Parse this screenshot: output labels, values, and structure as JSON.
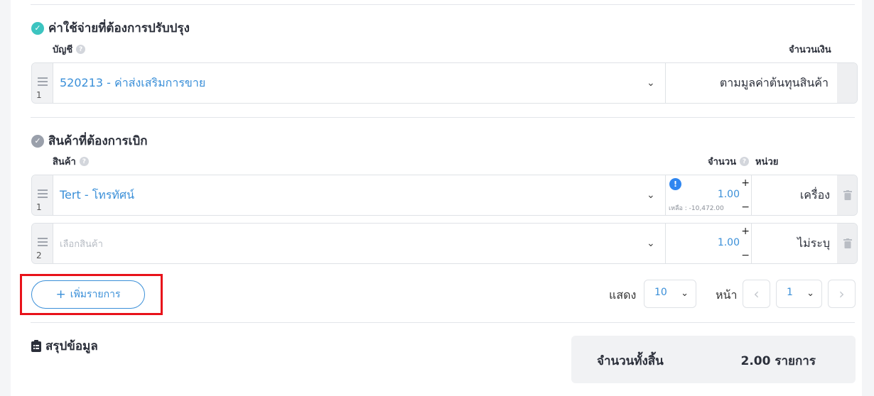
{
  "expense_section": {
    "title": "ค่าใช้จ่ายที่ต้องการปรับปรุง",
    "account_header": "บัญชี",
    "amount_header": "จำนวนเงิน",
    "rows": [
      {
        "index": "1",
        "account": "520213 - ค่าส่งเสริมการขาย",
        "amount": "ตามมูลค่าต้นทุนสินค้า"
      }
    ]
  },
  "product_section": {
    "title": "สินค้าที่ต้องการเบิก",
    "product_header": "สินค้า",
    "qty_header": "จำนวน",
    "unit_header": "หน่วย",
    "rows": [
      {
        "index": "1",
        "product": "Tert - โทรทัศน์",
        "qty": "1.00",
        "remaining": "เหลือ : -10,472.00",
        "unit": "เครื่อง"
      },
      {
        "index": "2",
        "product_placeholder": "เลือกสินค้า",
        "qty": "1.00",
        "unit": "ไม่ระบุ"
      }
    ]
  },
  "add_button": {
    "label": "เพิ่มรายการ",
    "icon": "+"
  },
  "pagination": {
    "show_label": "แสดง",
    "page_size": "10",
    "page_label": "หน้า",
    "current_page": "1"
  },
  "summary": {
    "title": "สรุปข้อมูล",
    "total_label": "จำนวนทั้งสิ้น",
    "total_value": "2.00 รายการ"
  },
  "colors": {
    "link_blue": "#3a8fd8",
    "teal_check": "#3cc4c0",
    "highlight_red": "#e8121a",
    "warning_blue": "#2f86f0"
  }
}
